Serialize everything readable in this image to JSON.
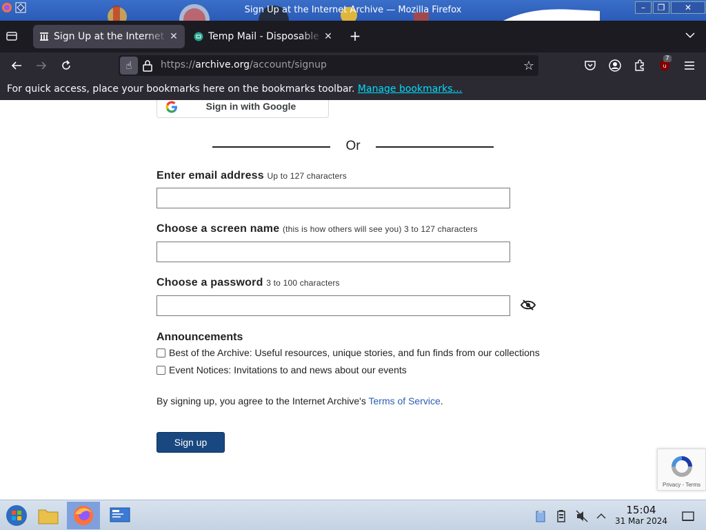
{
  "window": {
    "title": "Sign Up at the Internet Archive — Mozilla Firefox",
    "controls": {
      "minimize": "–",
      "maximize": "❐",
      "close": "✕"
    }
  },
  "tabs": [
    {
      "title": "Sign Up at the Internet Archive",
      "active": true,
      "icon": "archive-icon"
    },
    {
      "title": "Temp Mail - Disposable Temporary Email",
      "active": false,
      "icon": "tempmail-icon"
    }
  ],
  "newtab_label": "+",
  "navbar": {
    "url_prefix": "https://",
    "url_host": "archive.org",
    "url_path": "/account/signup",
    "extension_badge": "7"
  },
  "bookmarks": {
    "message": "For quick access, place your bookmarks here on the bookmarks toolbar.",
    "link": "Manage bookmarks…"
  },
  "page": {
    "google_button": "Sign in with Google",
    "or_text": "Or",
    "email": {
      "label": "Enter email address",
      "hint": "Up to 127 characters",
      "value": ""
    },
    "screen_name": {
      "label": "Choose a screen name",
      "hint": "(this is how others will see you) 3 to 127 characters",
      "value": ""
    },
    "password": {
      "label": "Choose a password",
      "hint": "3 to 100 characters",
      "value": ""
    },
    "announcements": {
      "title": "Announcements",
      "options": [
        {
          "label": "Best of the Archive: Useful resources, unique stories, and fun finds from our collections",
          "checked": false
        },
        {
          "label": "Event Notices: Invitations to and news about our events",
          "checked": false
        }
      ]
    },
    "terms_prefix": "By signing up, you agree to the Internet Archive's ",
    "terms_link": "Terms of Service",
    "terms_suffix": ".",
    "signup_button": "Sign up",
    "recaptcha_text": "Privacy - Terms"
  },
  "taskbar": {
    "time": "15:04",
    "date": "31 Mar 2024"
  },
  "colors": {
    "signup_button": "#194880",
    "link": "#2a5db0",
    "bookmark_link": "#00ddff",
    "tab_strip": "#1c1b22",
    "toolbar": "#2b2a33"
  }
}
